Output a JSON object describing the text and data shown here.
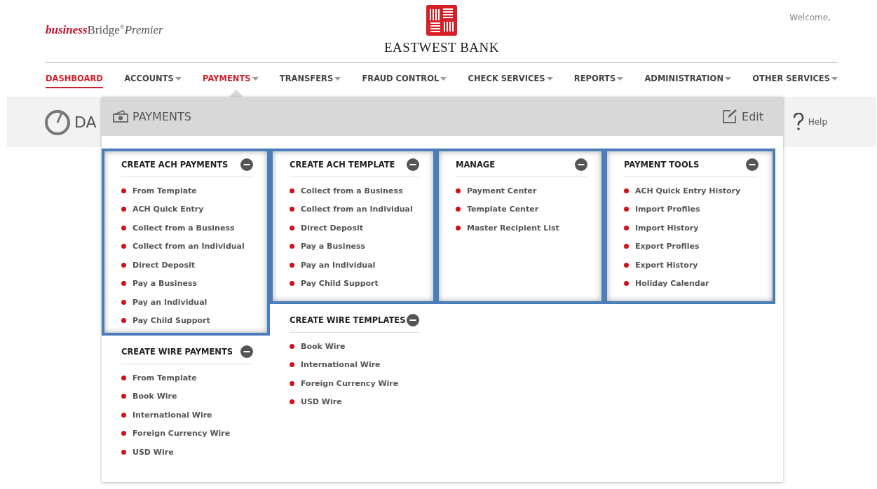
{
  "brand": {
    "prefix": "business",
    "rest": "Bridge$^{®}$*Premier*"
  },
  "bank_logo": {
    "name": "EASTWEST BANK"
  },
  "welcome": "Welcome,",
  "nav": [
    {
      "label": "DASHBOARD",
      "selected": true,
      "open": false,
      "caret": false
    },
    {
      "label": "ACCOUNTS",
      "selected": false,
      "open": false,
      "caret": true
    },
    {
      "label": "PAYMENTS",
      "selected": false,
      "open": true,
      "caret": true
    },
    {
      "label": "TRANSFERS",
      "selected": false,
      "open": false,
      "caret": true
    },
    {
      "label": "FRAUD CONTROL",
      "selected": false,
      "open": false,
      "caret": true
    },
    {
      "label": "CHECK SERVICES",
      "selected": false,
      "open": false,
      "caret": true
    },
    {
      "label": "REPORTS",
      "selected": false,
      "open": false,
      "caret": true
    },
    {
      "label": "ADMINISTRATION",
      "selected": false,
      "open": false,
      "caret": true
    },
    {
      "label": "OTHER SERVICES",
      "selected": false,
      "open": false,
      "caret": true
    }
  ],
  "page_header": {
    "title": "DA",
    "help": "Help"
  },
  "menu": {
    "title": "PAYMENTS",
    "edit": "Edit",
    "columns": [
      [
        {
          "title": "CREATE ACH PAYMENTS",
          "highlighted": true,
          "items": [
            "From Template",
            "ACH Quick Entry",
            "Collect from a Business",
            "Collect from an Individual",
            "Direct Deposit",
            "Pay a Business",
            "Pay an Individual",
            "Pay Child Support"
          ]
        },
        {
          "title": "CREATE WIRE PAYMENTS",
          "highlighted": false,
          "items": [
            "From Template",
            "Book Wire",
            "International Wire",
            "Foreign Currency Wire",
            "USD Wire"
          ]
        }
      ],
      [
        {
          "title": "CREATE ACH TEMPLATE",
          "highlighted": true,
          "items": [
            "Collect from a Business",
            "Collect from an Individual",
            "Direct Deposit",
            "Pay a Business",
            "Pay an Individual",
            "Pay Child Support"
          ]
        },
        {
          "title": "CREATE WIRE TEMPLATES",
          "highlighted": false,
          "items": [
            "Book Wire",
            "International Wire",
            "Foreign Currency Wire",
            "USD Wire"
          ]
        }
      ],
      [
        {
          "title": "MANAGE",
          "highlighted": true,
          "items": [
            "Payment Center",
            "Template Center",
            "Master Recipient List"
          ]
        }
      ],
      [
        {
          "title": "PAYMENT TOOLS",
          "highlighted": true,
          "items": [
            "ACH Quick Entry History",
            "Import Profiles",
            "Import History",
            "Export Profiles",
            "Export History",
            "Holiday Calendar"
          ]
        }
      ]
    ]
  }
}
